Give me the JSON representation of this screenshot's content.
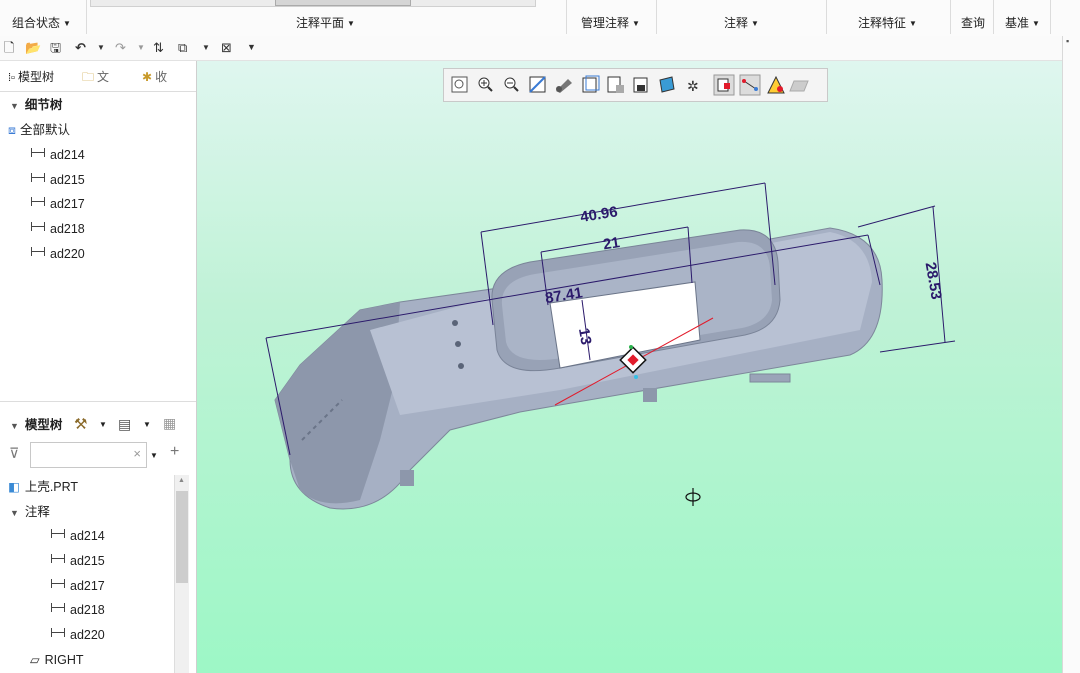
{
  "ribbon": {
    "groups": [
      {
        "label": "组合状态"
      },
      {
        "label": "注释平面"
      },
      {
        "label": "管理注释"
      },
      {
        "label": "注释"
      },
      {
        "label": "注释特征"
      },
      {
        "label": "查询"
      },
      {
        "label": "基准"
      }
    ]
  },
  "left_panel": {
    "tabs": [
      "模型树",
      "文",
      "收"
    ],
    "detail_tree_title": "细节树",
    "detail_root": "全部默认",
    "detail_items": [
      "ad214",
      "ad215",
      "ad217",
      "ad218",
      "ad220"
    ],
    "model_tree_title": "模型树",
    "search_placeholder": "",
    "part_name": "上壳.PRT",
    "annotations_label": "注释",
    "annotation_items": [
      "ad214",
      "ad215",
      "ad217",
      "ad218",
      "ad220"
    ],
    "plane_label": "RIGHT"
  },
  "viewport": {
    "dimensions": {
      "d1": "40.96",
      "d2": "21",
      "d3": "87.41",
      "d4": "13",
      "d5": "28.53"
    },
    "colors": {
      "dimension": "#2b1a6b",
      "bg_top": "#dff6ef",
      "bg_bottom": "#9df7c6",
      "part": "#a9b3c6"
    }
  }
}
